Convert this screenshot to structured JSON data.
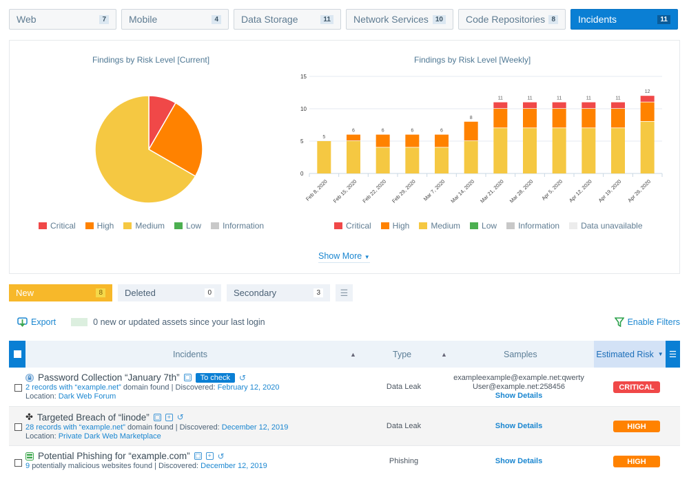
{
  "top_tabs": [
    {
      "label": "Web",
      "count": "7",
      "active": false
    },
    {
      "label": "Mobile",
      "count": "4",
      "active": false
    },
    {
      "label": "Data Storage",
      "count": "11",
      "active": false
    },
    {
      "label": "Network Services",
      "count": "10",
      "active": false
    },
    {
      "label": "Code Repositories",
      "count": "8",
      "active": false
    },
    {
      "label": "Incidents",
      "count": "11",
      "active": true
    }
  ],
  "colors": {
    "critical": "#f04848",
    "high": "#ff8200",
    "medium": "#f5c842",
    "low": "#4caf50",
    "information": "#c8c8c8",
    "unavailable": "#ececec",
    "accent": "#0a7fd4"
  },
  "chart_data": [
    {
      "type": "pie",
      "title": "Findings by Risk Level [Current]",
      "labels": [
        "Critical",
        "High",
        "Medium",
        "Low",
        "Information"
      ],
      "values": [
        1,
        3,
        8,
        0,
        0
      ],
      "legend": [
        "Critical",
        "High",
        "Medium",
        "Low",
        "Information"
      ],
      "legend_position": "bottom"
    },
    {
      "type": "bar",
      "stacked": true,
      "title": "Findings by Risk Level [Weekly]",
      "categories": [
        "Feb 8, 2020",
        "Feb 15, 2020",
        "Feb 22, 2020",
        "Feb 29, 2020",
        "Mar 7, 2020",
        "Mar 14, 2020",
        "Mar 21, 2020",
        "Mar 28, 2020",
        "Apr 5, 2020",
        "Apr 12, 2020",
        "Apr 19, 2020",
        "Apr 26, 2020"
      ],
      "series": [
        {
          "name": "Medium",
          "values": [
            5,
            5,
            4,
            4,
            4,
            5,
            7,
            7,
            7,
            7,
            7,
            8
          ]
        },
        {
          "name": "High",
          "values": [
            0,
            1,
            2,
            2,
            2,
            3,
            3,
            3,
            3,
            3,
            3,
            3
          ]
        },
        {
          "name": "Critical",
          "values": [
            0,
            0,
            0,
            0,
            0,
            0,
            1,
            1,
            1,
            1,
            1,
            1
          ]
        }
      ],
      "totals": [
        5,
        6,
        6,
        6,
        6,
        8,
        11,
        11,
        11,
        11,
        11,
        12
      ],
      "yticks": [
        "0",
        "5",
        "10",
        "15"
      ],
      "ylim": [
        0,
        15
      ],
      "grid": true,
      "legend": [
        "Critical",
        "High",
        "Medium",
        "Low",
        "Information",
        "Data unavailable"
      ],
      "legend_position": "bottom"
    }
  ],
  "show_more": "Show More",
  "sub_tabs": [
    {
      "label": "New",
      "count": "8",
      "active": true
    },
    {
      "label": "Deleted",
      "count": "0",
      "active": false
    },
    {
      "label": "Secondary",
      "count": "3",
      "active": false
    }
  ],
  "toolbar": {
    "export": "Export",
    "new_assets": "0  new or updated assets since your last login",
    "enable_filters": "Enable Filters"
  },
  "table": {
    "headers": {
      "incidents": "Incidents",
      "type": "Type",
      "samples": "Samples",
      "risk": "Estimated Risk"
    },
    "rows": [
      {
        "title": "Password Collection “January 7th”",
        "tag": "To check",
        "records": "2 records with",
        "domain": "“example.net”",
        "found": "domain found | Discovered:",
        "date": "February 12, 2020",
        "location_label": "Location:",
        "location": "Dark Web Forum",
        "type": "Data Leak",
        "samples": [
          "exampleexample@example.net:qwerty",
          "User@example.net:258456"
        ],
        "details": "Show Details",
        "risk": "CRITICAL",
        "risk_color": "#f04848"
      },
      {
        "title": "Targeted Breach of “linode”",
        "records": "28 records with",
        "domain": "“example.net”",
        "found": "domain found | Discovered:",
        "date": "December 12, 2019",
        "location_label": "Location:",
        "location": "Private Dark Web Marketplace",
        "type": "Data Leak",
        "details": "Show Details",
        "risk": "HIGH",
        "risk_color": "#ff8200"
      },
      {
        "title": "Potential Phishing for “example.com”",
        "records": "9",
        "found": "potentially malicious websites found | Discovered:",
        "date": "December 12, 2019",
        "type": "Phishing",
        "details": "Show Details",
        "risk": "HIGH",
        "risk_color": "#ff8200"
      }
    ]
  }
}
